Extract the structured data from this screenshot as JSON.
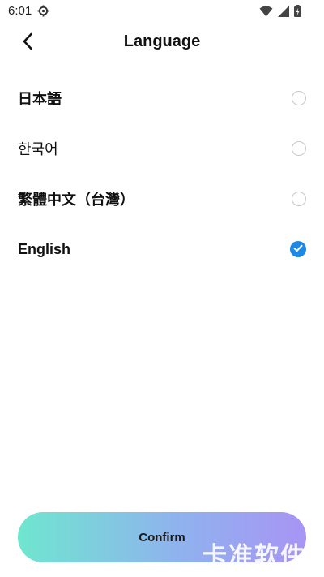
{
  "status_bar": {
    "time": "6:01",
    "icons": [
      "settings-gear-icon",
      "wifi-icon",
      "signal-icon",
      "battery-icon"
    ]
  },
  "header": {
    "back_icon": "chevron-left-icon",
    "title": "Language"
  },
  "languages": [
    {
      "label": "日本語",
      "selected": false
    },
    {
      "label": "한국어",
      "selected": false
    },
    {
      "label": "繁體中文（台灣）",
      "selected": false
    },
    {
      "label": "English",
      "selected": true
    }
  ],
  "confirm": {
    "label": "Confirm"
  },
  "watermark": "卡准软件",
  "colors": {
    "accent": "#1e88e5",
    "gradient_start": "#6fe6cf",
    "gradient_end": "#a894f4"
  }
}
